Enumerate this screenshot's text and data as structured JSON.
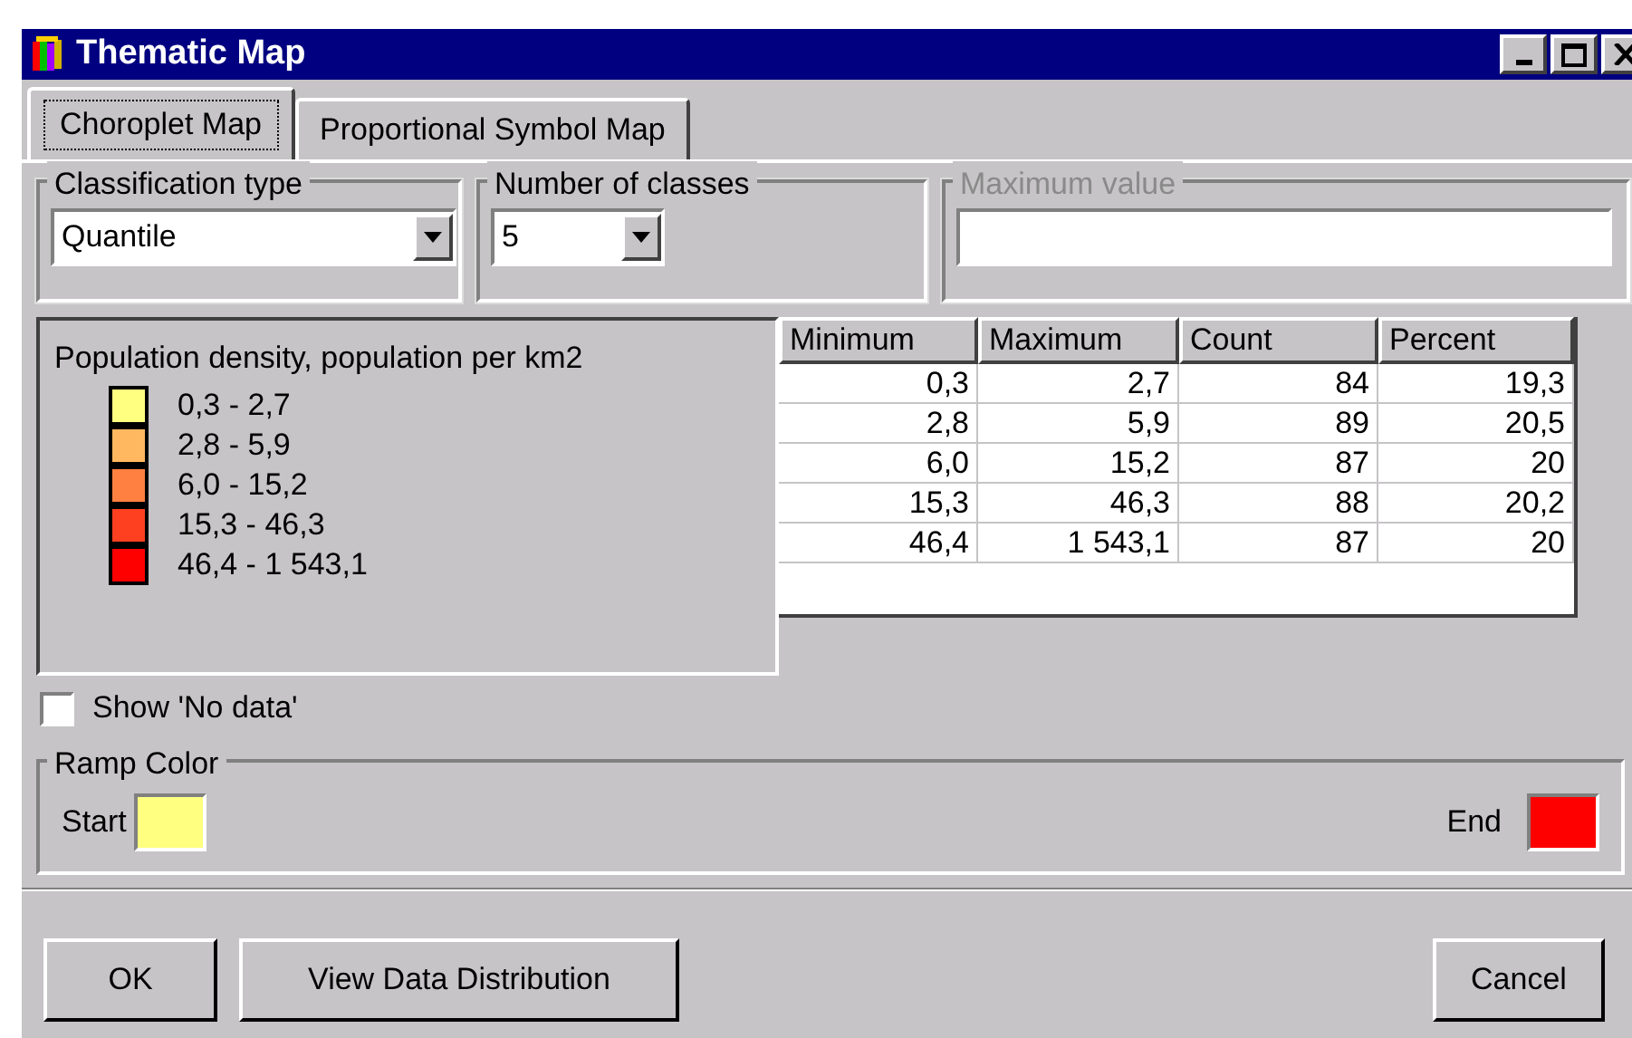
{
  "window": {
    "title": "Thematic Map"
  },
  "tabs": [
    {
      "label": "Choroplet Map",
      "selected": true
    },
    {
      "label": "Proportional Symbol Map",
      "selected": false
    }
  ],
  "classification_type": {
    "label": "Classification type",
    "value": "Quantile"
  },
  "number_of_classes": {
    "label": "Number of classes",
    "value": "5"
  },
  "maximum_value": {
    "label": "Maximum value",
    "disabled": true
  },
  "legend": {
    "title": "Population density, population per km2",
    "items": [
      {
        "label": "0,3 - 2,7",
        "color": "#ffff80"
      },
      {
        "label": "2,8 - 5,9",
        "color": "#ffb860"
      },
      {
        "label": "6,0 - 15,2",
        "color": "#ff8040"
      },
      {
        "label": "15,3 - 46,3",
        "color": "#ff4020"
      },
      {
        "label": "46,4 - 1 543,1",
        "color": "#ff0000"
      }
    ]
  },
  "table": {
    "columns": [
      "Minimum",
      "Maximum",
      "Count",
      "Percent"
    ],
    "rows": [
      [
        "0,3",
        "2,7",
        "84",
        "19,3"
      ],
      [
        "2,8",
        "5,9",
        "89",
        "20,5"
      ],
      [
        "6,0",
        "15,2",
        "87",
        "20"
      ],
      [
        "15,3",
        "46,3",
        "88",
        "20,2"
      ],
      [
        "46,4",
        "1 543,1",
        "87",
        "20"
      ]
    ]
  },
  "show_no_data": {
    "label": "Show 'No data'",
    "checked": false
  },
  "ramp_color": {
    "label": "Ramp Color",
    "start": {
      "label": "Start",
      "color": "#ffff80"
    },
    "end": {
      "label": "End",
      "color": "#ff0000"
    }
  },
  "buttons": [
    "OK",
    "View Data Distribution",
    "Cancel"
  ]
}
